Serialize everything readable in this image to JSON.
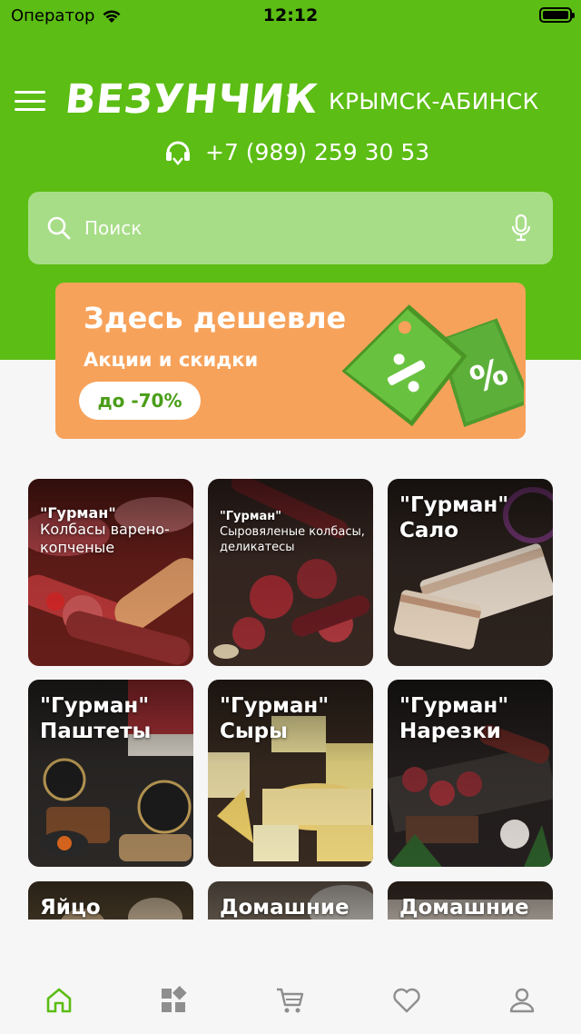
{
  "status_bar": {
    "carrier": "Оператор",
    "time": "12:12"
  },
  "header": {
    "logo": "ВЕЗУНЧИК",
    "region": "КРЫМСК-АБИНСК",
    "phone": "+7 (989) 259 30 53"
  },
  "search": {
    "placeholder": "Поиск"
  },
  "promo": {
    "title": "Здесь дешевле",
    "subtitle": "Акции и скидки",
    "badge": "до -70%"
  },
  "categories": [
    {
      "line1": "\"Гурман\"",
      "line2": "Колбасы варено-копченые"
    },
    {
      "line1": "\"Гурман\"",
      "line2": "Сыровяленые колбасы, деликатесы"
    },
    {
      "line1": "\"Гурман\"",
      "line2": "Сало"
    },
    {
      "line1": "\"Гурман\"",
      "line2": "Паштеты"
    },
    {
      "line1": "\"Гурман\"",
      "line2": "Сыры"
    },
    {
      "line1": "\"Гурман\"",
      "line2": "Нарезки"
    },
    {
      "line1": "Яйцо",
      "line2": ""
    },
    {
      "line1": "Домашние",
      "line2": ""
    },
    {
      "line1": "Домашние",
      "line2": ""
    }
  ],
  "tabs": [
    "home-icon",
    "catalog-icon",
    "cart-icon",
    "favorites-icon",
    "profile-icon"
  ],
  "colors": {
    "brand_green": "#5cbd14",
    "promo_orange": "#f7a25a",
    "active_tab": "#5cbd14",
    "inactive_tab": "#8e8e8e"
  }
}
